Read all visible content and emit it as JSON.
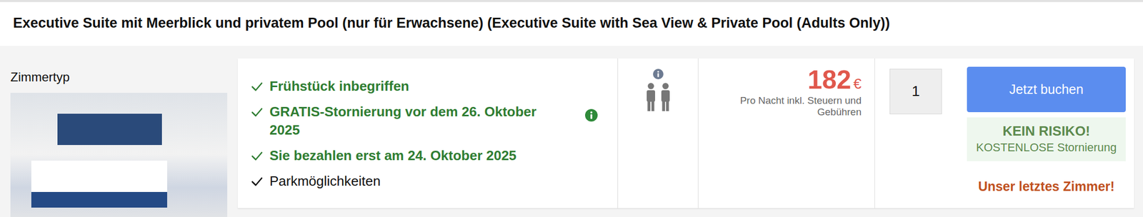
{
  "room": {
    "title": "Executive Suite mit Meerblick und privatem Pool (nur für Erwachsene) (Executive Suite with Sea View & Private Pool (Adults Only))",
    "type_label": "Zimmertyp"
  },
  "features": [
    {
      "text": "Frühstück inbegriffen",
      "kind": "highlight",
      "info": false
    },
    {
      "text": "GRATIS-Stornierung vor dem 26. Oktober 2025",
      "kind": "highlight",
      "info": true
    },
    {
      "text": "Sie bezahlen erst am 24. Oktober 2025",
      "kind": "highlight",
      "info": false
    },
    {
      "text": "Parkmöglichkeiten",
      "kind": "plain",
      "info": false
    }
  ],
  "price": {
    "amount": "182",
    "currency": "€",
    "note": "Pro Nacht inkl. Steuern und Gebühren"
  },
  "quantity": {
    "value": "1"
  },
  "book_button": "Jetzt buchen",
  "guarantee": {
    "title": "KEIN RISIKO!",
    "text": "KOSTENLOSE Stornierung"
  },
  "scarcity": "Unser letztes Zimmer!"
}
